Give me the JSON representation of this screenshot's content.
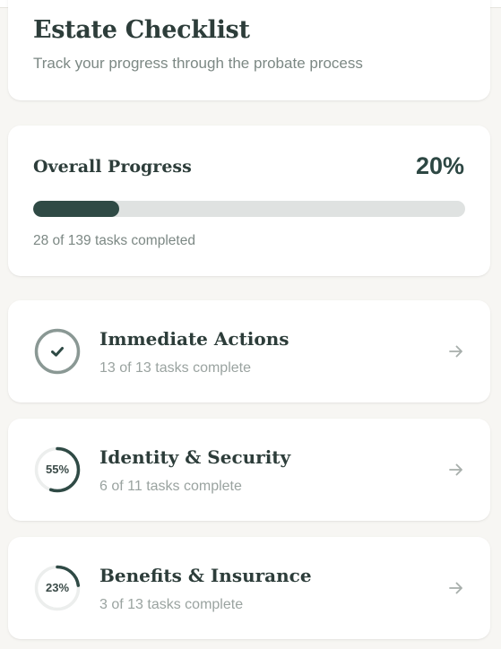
{
  "header": {
    "title": "Estate Checklist",
    "subtitle": "Track your progress through the probate process"
  },
  "progress": {
    "title": "Overall Progress",
    "percent_label": "20%",
    "fraction": 0.2,
    "caption": "28 of 139 tasks completed"
  },
  "categories": [
    {
      "title": "Immediate Actions",
      "subtitle": "13 of 13 tasks complete",
      "percent": 100,
      "percent_label": "",
      "complete": true,
      "status_icon": "check-icon"
    },
    {
      "title": "Identity & Security",
      "subtitle": "6 of 11 tasks complete",
      "percent": 55,
      "percent_label": "55%",
      "complete": false
    },
    {
      "title": "Benefits & Insurance",
      "subtitle": "3 of 13 tasks complete",
      "percent": 23,
      "percent_label": "23%",
      "complete": false
    }
  ],
  "colors": {
    "accent": "#2f4a45",
    "track": "#dfe2e1",
    "ring_track": "#eceeed",
    "complete_ring": "#8a9894",
    "arrow": "#a7aeab"
  }
}
